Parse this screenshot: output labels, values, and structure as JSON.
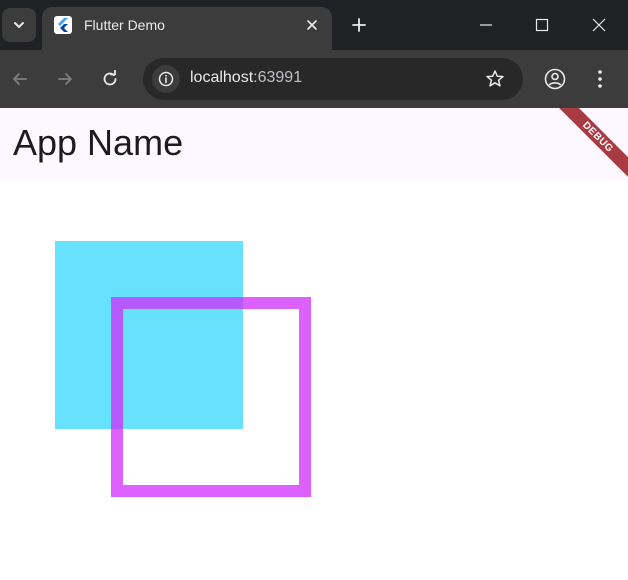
{
  "browser": {
    "tab_title": "Flutter Demo",
    "url_host": "localhost",
    "url_port": ":63991",
    "icons": {
      "tab_search": "chevron-down-icon",
      "favicon": "flutter-logo-icon",
      "close_tab": "close-icon",
      "new_tab": "plus-icon",
      "minimize": "minimize-icon",
      "maximize": "maximize-icon",
      "close_window": "close-icon",
      "back": "arrow-left-icon",
      "forward": "arrow-right-icon",
      "reload": "reload-icon",
      "site_info": "info-icon",
      "bookmark": "star-icon",
      "profile": "account-circle-icon",
      "menu": "more-vertical-icon"
    }
  },
  "app": {
    "title": "App Name",
    "debug_label": "DEBUG",
    "colors": {
      "appbar_bg": "#fdf7ff",
      "filled_square": "#00cfff",
      "outlined_square": "#d12cff"
    }
  }
}
